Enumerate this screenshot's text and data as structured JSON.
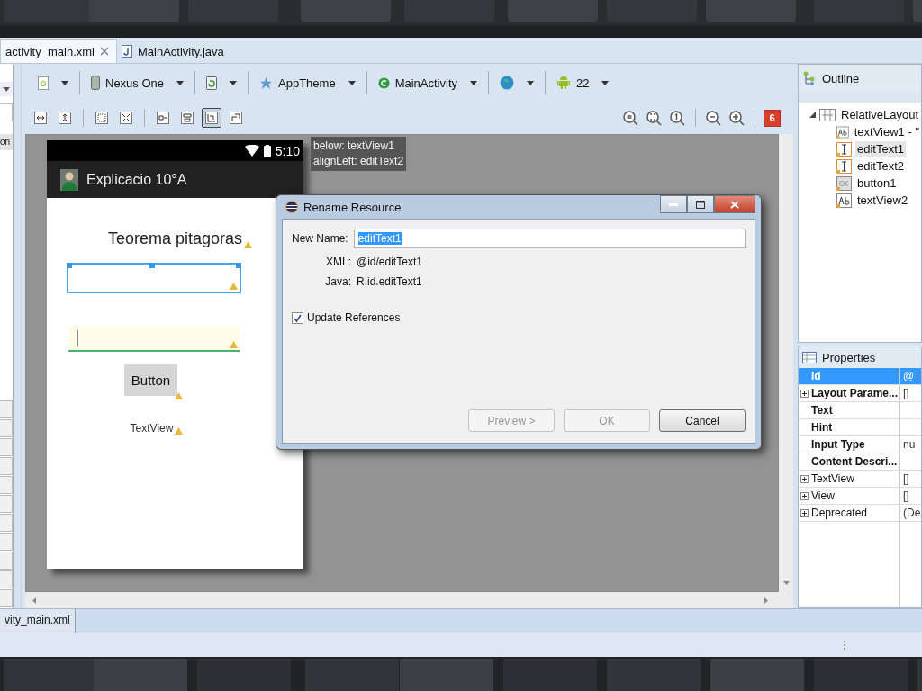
{
  "editor_tabs": [
    {
      "label": "activity_main.xml",
      "selected": true,
      "closable": true
    },
    {
      "label": "MainActivity.java",
      "selected": false,
      "closable": false
    }
  ],
  "left_panel": {
    "button_text": "on"
  },
  "config_toolbar": [
    {
      "kind": "file"
    },
    {
      "kind": "device",
      "label": "Nexus One"
    },
    {
      "kind": "rotate"
    },
    {
      "kind": "theme",
      "label": "AppTheme"
    },
    {
      "kind": "activity",
      "label": "MainActivity"
    },
    {
      "kind": "locale"
    },
    {
      "kind": "api",
      "label": "22"
    }
  ],
  "layout_actions": [
    {
      "kind": "hfill",
      "selected": false
    },
    {
      "kind": "vfill",
      "selected": false
    },
    {
      "kind": "margins",
      "selected": false
    },
    {
      "kind": "expand",
      "selected": false
    },
    {
      "kind": "baseline",
      "selected": false
    },
    {
      "kind": "center",
      "selected": false
    },
    {
      "kind": "anchor",
      "selected": true
    },
    {
      "kind": "resize",
      "selected": false
    }
  ],
  "issues_badge": "6",
  "tooltip": [
    "below: textView1",
    "alignLeft: editText2"
  ],
  "phone": {
    "time": "5:10",
    "app_title": "Explicacio 10°A",
    "widgets": [
      {
        "kind": "title",
        "text": "Teorema pitagoras"
      },
      {
        "kind": "edit",
        "selected": true
      },
      {
        "kind": "edit",
        "selected": false
      },
      {
        "kind": "button",
        "text": "Button"
      },
      {
        "kind": "label",
        "text": "TextView"
      }
    ]
  },
  "dialog": {
    "title": "Rename Resource",
    "name_label": "New Name:",
    "new_name": "editText1",
    "xml_label": "XML:",
    "xml": "@id/editText1",
    "java_label": "Java:",
    "java": "R.id.editText1",
    "update_label": "Update References",
    "update_checked": true,
    "buttons": [
      {
        "label": "Preview >",
        "disabled": true
      },
      {
        "label": "OK",
        "disabled": true
      },
      {
        "label": "Cancel",
        "disabled": false
      }
    ]
  },
  "outline": {
    "title": "Outline",
    "tree": [
      {
        "label": "RelativeLayout",
        "kind": "layout",
        "expanded": true,
        "selected": false,
        "children": [
          {
            "label": "textView1 - \"",
            "kind": "text",
            "selected": false
          },
          {
            "label": "editText1",
            "kind": "edit",
            "selected": true
          },
          {
            "label": "editText2",
            "kind": "edit",
            "selected": false
          },
          {
            "label": "button1",
            "kind": "button",
            "selected": false
          },
          {
            "label": "textView2",
            "kind": "text",
            "selected": false
          }
        ]
      }
    ]
  },
  "properties": {
    "title": "Properties",
    "rows": [
      {
        "name": "Id",
        "value": "@",
        "bold": true,
        "expandable": false,
        "selected": true
      },
      {
        "name": "Layout Parame...",
        "value": "[]",
        "bold": true,
        "expandable": true,
        "selected": false
      },
      {
        "name": "Text",
        "bold": true,
        "expandable": false,
        "selected": false
      },
      {
        "name": "Hint",
        "bold": true,
        "expandable": false,
        "selected": false
      },
      {
        "name": "Input Type",
        "value": "nu",
        "bold": true,
        "expandable": false,
        "selected": false
      },
      {
        "name": "Content Descri...",
        "bold": true,
        "expandable": false,
        "selected": false
      },
      {
        "name": "TextView",
        "value": "[]",
        "bold": false,
        "expandable": true,
        "selected": false
      },
      {
        "name": "View",
        "value": "[]",
        "bold": false,
        "expandable": true,
        "selected": false
      },
      {
        "name": "Deprecated",
        "value": "(De",
        "bold": false,
        "expandable": true,
        "selected": false
      }
    ]
  },
  "bottom_tab": "vity_main.xml"
}
